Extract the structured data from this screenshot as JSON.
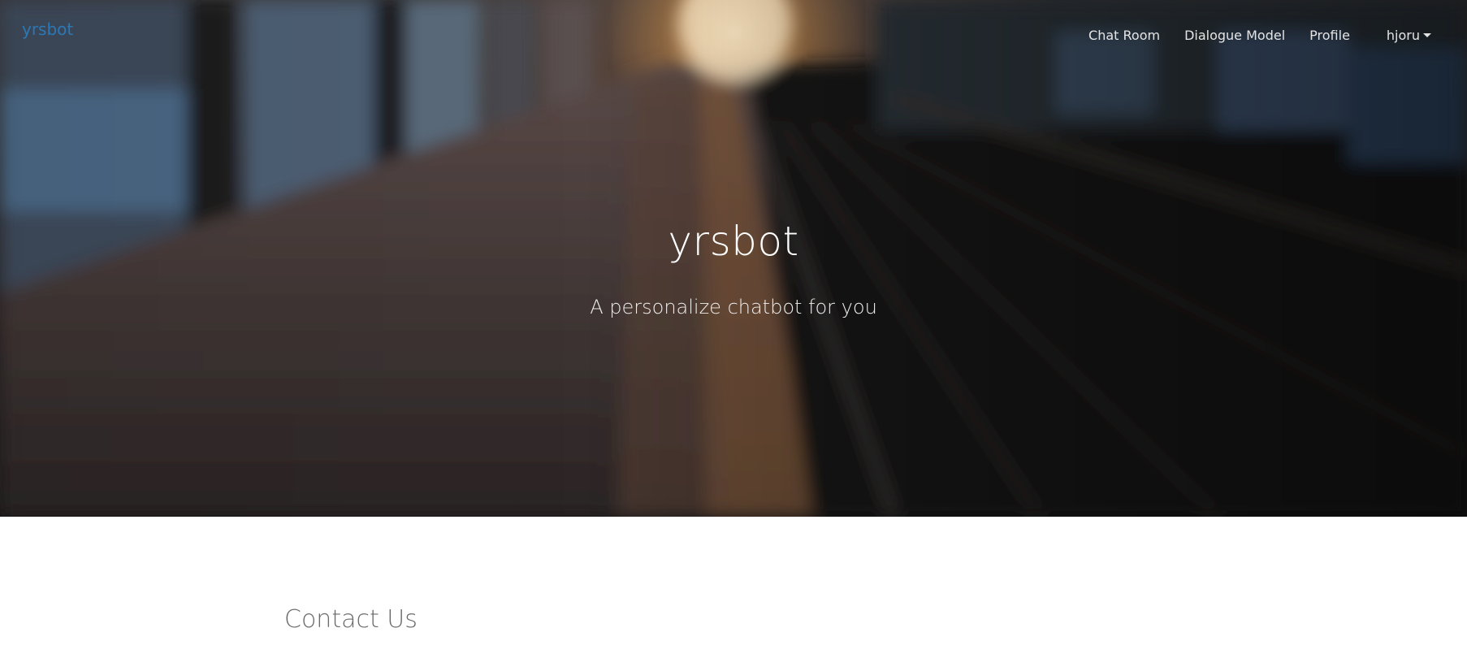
{
  "brand": {
    "label": "yrsbot",
    "color": "#2b78b5"
  },
  "nav": {
    "items": [
      {
        "label": "Chat Room"
      },
      {
        "label": "Dialogue Model"
      },
      {
        "label": "Profile"
      }
    ],
    "user": {
      "label": "hjoru",
      "icon": "caret-down-icon"
    }
  },
  "hero": {
    "title": "yrsbot",
    "subtitle": "A personalize chatbot for you",
    "image": "blurred-train-platform-sunset"
  },
  "contact": {
    "title": "Contact Us"
  }
}
